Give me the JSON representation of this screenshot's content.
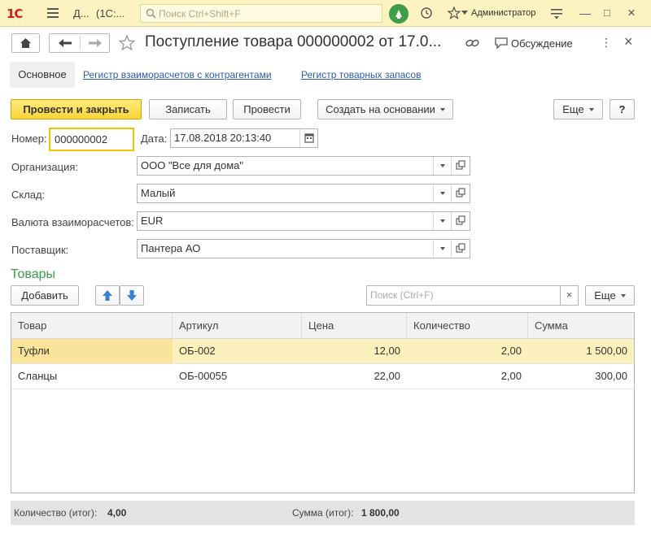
{
  "topbar": {
    "logo": "1С",
    "crumb_short": "Д...",
    "crumb_app": "(1С:...",
    "search_placeholder": "Поиск Ctrl+Shift+F",
    "user": "Администратор"
  },
  "header": {
    "title": "Поступление товара 000000002 от 17.0...",
    "discuss_label": "Обсуждение"
  },
  "tabs": [
    {
      "label": "Основное"
    },
    {
      "label": "Регистр взаиморасчетов с контрагентами"
    },
    {
      "label": "Регистр товарных запасов"
    }
  ],
  "commands": {
    "post_close": "Провести и закрыть",
    "save": "Записать",
    "post": "Провести",
    "create_based": "Создать на основании",
    "more": "Еще",
    "help": "?"
  },
  "form": {
    "number_label": "Номер:",
    "number_value": "000000002",
    "date_label": "Дата:",
    "date_value": "17.08.2018 20:13:40",
    "org_label": "Организация:",
    "org_value": "ООО \"Все для дома\"",
    "warehouse_label": "Склад:",
    "warehouse_value": "Малый",
    "currency_label": "Валюта взаиморасчетов:",
    "currency_value": "EUR",
    "supplier_label": "Поставщик:",
    "supplier_value": "Пантера АО"
  },
  "goods": {
    "title": "Товары",
    "add_label": "Добавить",
    "search_placeholder": "Поиск (Ctrl+F)",
    "more_label": "Еще",
    "columns": [
      "Товар",
      "Артикул",
      "Цена",
      "Количество",
      "Сумма"
    ],
    "rows": [
      {
        "item": "Туфли",
        "article": "ОБ-002",
        "price": "12,00",
        "qty": "2,00",
        "sum": "1 500,00"
      },
      {
        "item": "Сланцы",
        "article": "ОБ-00055",
        "price": "22,00",
        "qty": "2,00",
        "sum": "300,00"
      }
    ]
  },
  "footer": {
    "qty_label": "Количество (итог):",
    "qty_value": "4,00",
    "sum_label": "Сумма (итог):",
    "sum_value": "1 800,00"
  },
  "colors": {
    "accent_yellow": "#fbd637",
    "topbar_bg": "#fcf3c0",
    "selected_row": "#fcf1bd",
    "section_title": "#3a9a4a",
    "link": "#2a5db0"
  }
}
